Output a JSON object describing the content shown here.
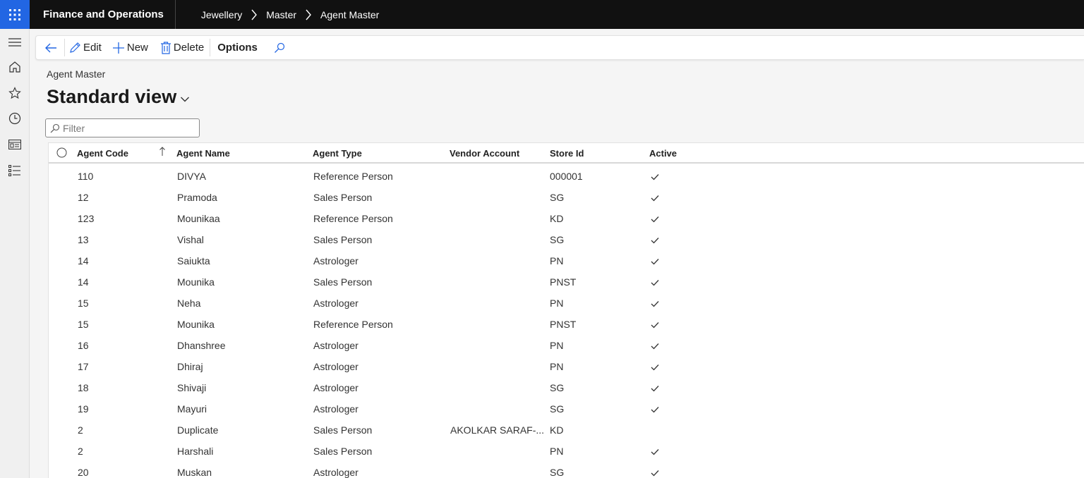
{
  "header": {
    "app_title": "Finance and Operations",
    "breadcrumbs": [
      "Jewellery",
      "Master",
      "Agent Master"
    ]
  },
  "nav": {
    "items": [
      "hamburger-icon",
      "home-icon",
      "star-icon",
      "clock-icon",
      "workspace-icon",
      "list-icon"
    ]
  },
  "toolbar": {
    "edit_label": "Edit",
    "new_label": "New",
    "delete_label": "Delete",
    "options_label": "Options"
  },
  "page": {
    "label": "Agent Master",
    "view_title": "Standard view",
    "filter_placeholder": "Filter"
  },
  "grid": {
    "columns": [
      "Agent Code",
      "Agent Name",
      "Agent Type",
      "Vendor Account",
      "Store Id",
      "Active"
    ],
    "sort_column": "Agent Code",
    "sort_direction": "ascending",
    "rows": [
      {
        "code": "110",
        "name": "DIVYA",
        "type": "Reference Person",
        "vendor": "",
        "store": "000001",
        "active": true
      },
      {
        "code": "12",
        "name": "Pramoda",
        "type": "Sales Person",
        "vendor": "",
        "store": "SG",
        "active": true
      },
      {
        "code": "123",
        "name": "Mounikaa",
        "type": "Reference Person",
        "vendor": "",
        "store": "KD",
        "active": true
      },
      {
        "code": "13",
        "name": "Vishal",
        "type": "Sales Person",
        "vendor": "",
        "store": "SG",
        "active": true
      },
      {
        "code": "14",
        "name": "Saiukta",
        "type": "Astrologer",
        "vendor": "",
        "store": "PN",
        "active": true
      },
      {
        "code": "14",
        "name": "Mounika",
        "type": "Sales Person",
        "vendor": "",
        "store": "PNST",
        "active": true
      },
      {
        "code": "15",
        "name": "Neha",
        "type": "Astrologer",
        "vendor": "",
        "store": "PN",
        "active": true
      },
      {
        "code": "15",
        "name": "Mounika",
        "type": "Reference Person",
        "vendor": "",
        "store": "PNST",
        "active": true
      },
      {
        "code": "16",
        "name": "Dhanshree",
        "type": "Astrologer",
        "vendor": "",
        "store": "PN",
        "active": true
      },
      {
        "code": "17",
        "name": "Dhiraj",
        "type": "Astrologer",
        "vendor": "",
        "store": "PN",
        "active": true
      },
      {
        "code": "18",
        "name": "Shivaji",
        "type": "Astrologer",
        "vendor": "",
        "store": "SG",
        "active": true
      },
      {
        "code": "19",
        "name": "Mayuri",
        "type": "Astrologer",
        "vendor": "",
        "store": "SG",
        "active": true
      },
      {
        "code": "2",
        "name": "Duplicate",
        "type": "Sales Person",
        "vendor": "AKOLKAR SARAF-...",
        "store": "KD",
        "active": false
      },
      {
        "code": "2",
        "name": "Harshali",
        "type": "Sales Person",
        "vendor": "",
        "store": "PN",
        "active": true
      },
      {
        "code": "20",
        "name": "Muskan",
        "type": "Astrologer",
        "vendor": "",
        "store": "SG",
        "active": true
      }
    ]
  },
  "colors": {
    "topbar": "#111111",
    "waffle": "#2266e3",
    "accent": "#2266e3"
  }
}
